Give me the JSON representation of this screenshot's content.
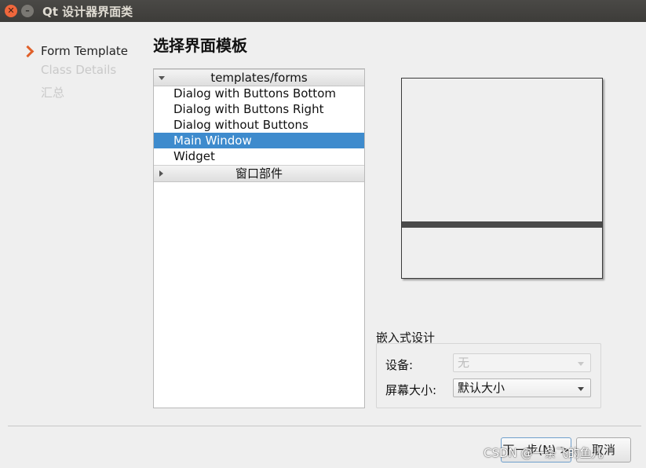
{
  "window": {
    "title": "Qt 设计器界面类"
  },
  "steps": {
    "items": [
      "Form Template",
      "Class Details",
      "汇总"
    ]
  },
  "page": {
    "title": "选择界面模板"
  },
  "tree": {
    "group1": "templates/forms",
    "items": [
      "Dialog with Buttons Bottom",
      "Dialog with Buttons Right",
      "Dialog without Buttons",
      "Main Window",
      "Widget"
    ],
    "selected": "Main Window",
    "group2": "窗口部件"
  },
  "embedded": {
    "title": "嵌入式设计",
    "device_label": "设备:",
    "device_value": "无",
    "screen_label": "屏幕大小:",
    "screen_value": "默认大小"
  },
  "buttons": {
    "next": "下一步(N) >",
    "cancel": "取消"
  },
  "watermark": "CSDN @一条飞的鱼儿",
  "colors": {
    "accent": "#e0602a",
    "selection": "#3e8bcd"
  }
}
